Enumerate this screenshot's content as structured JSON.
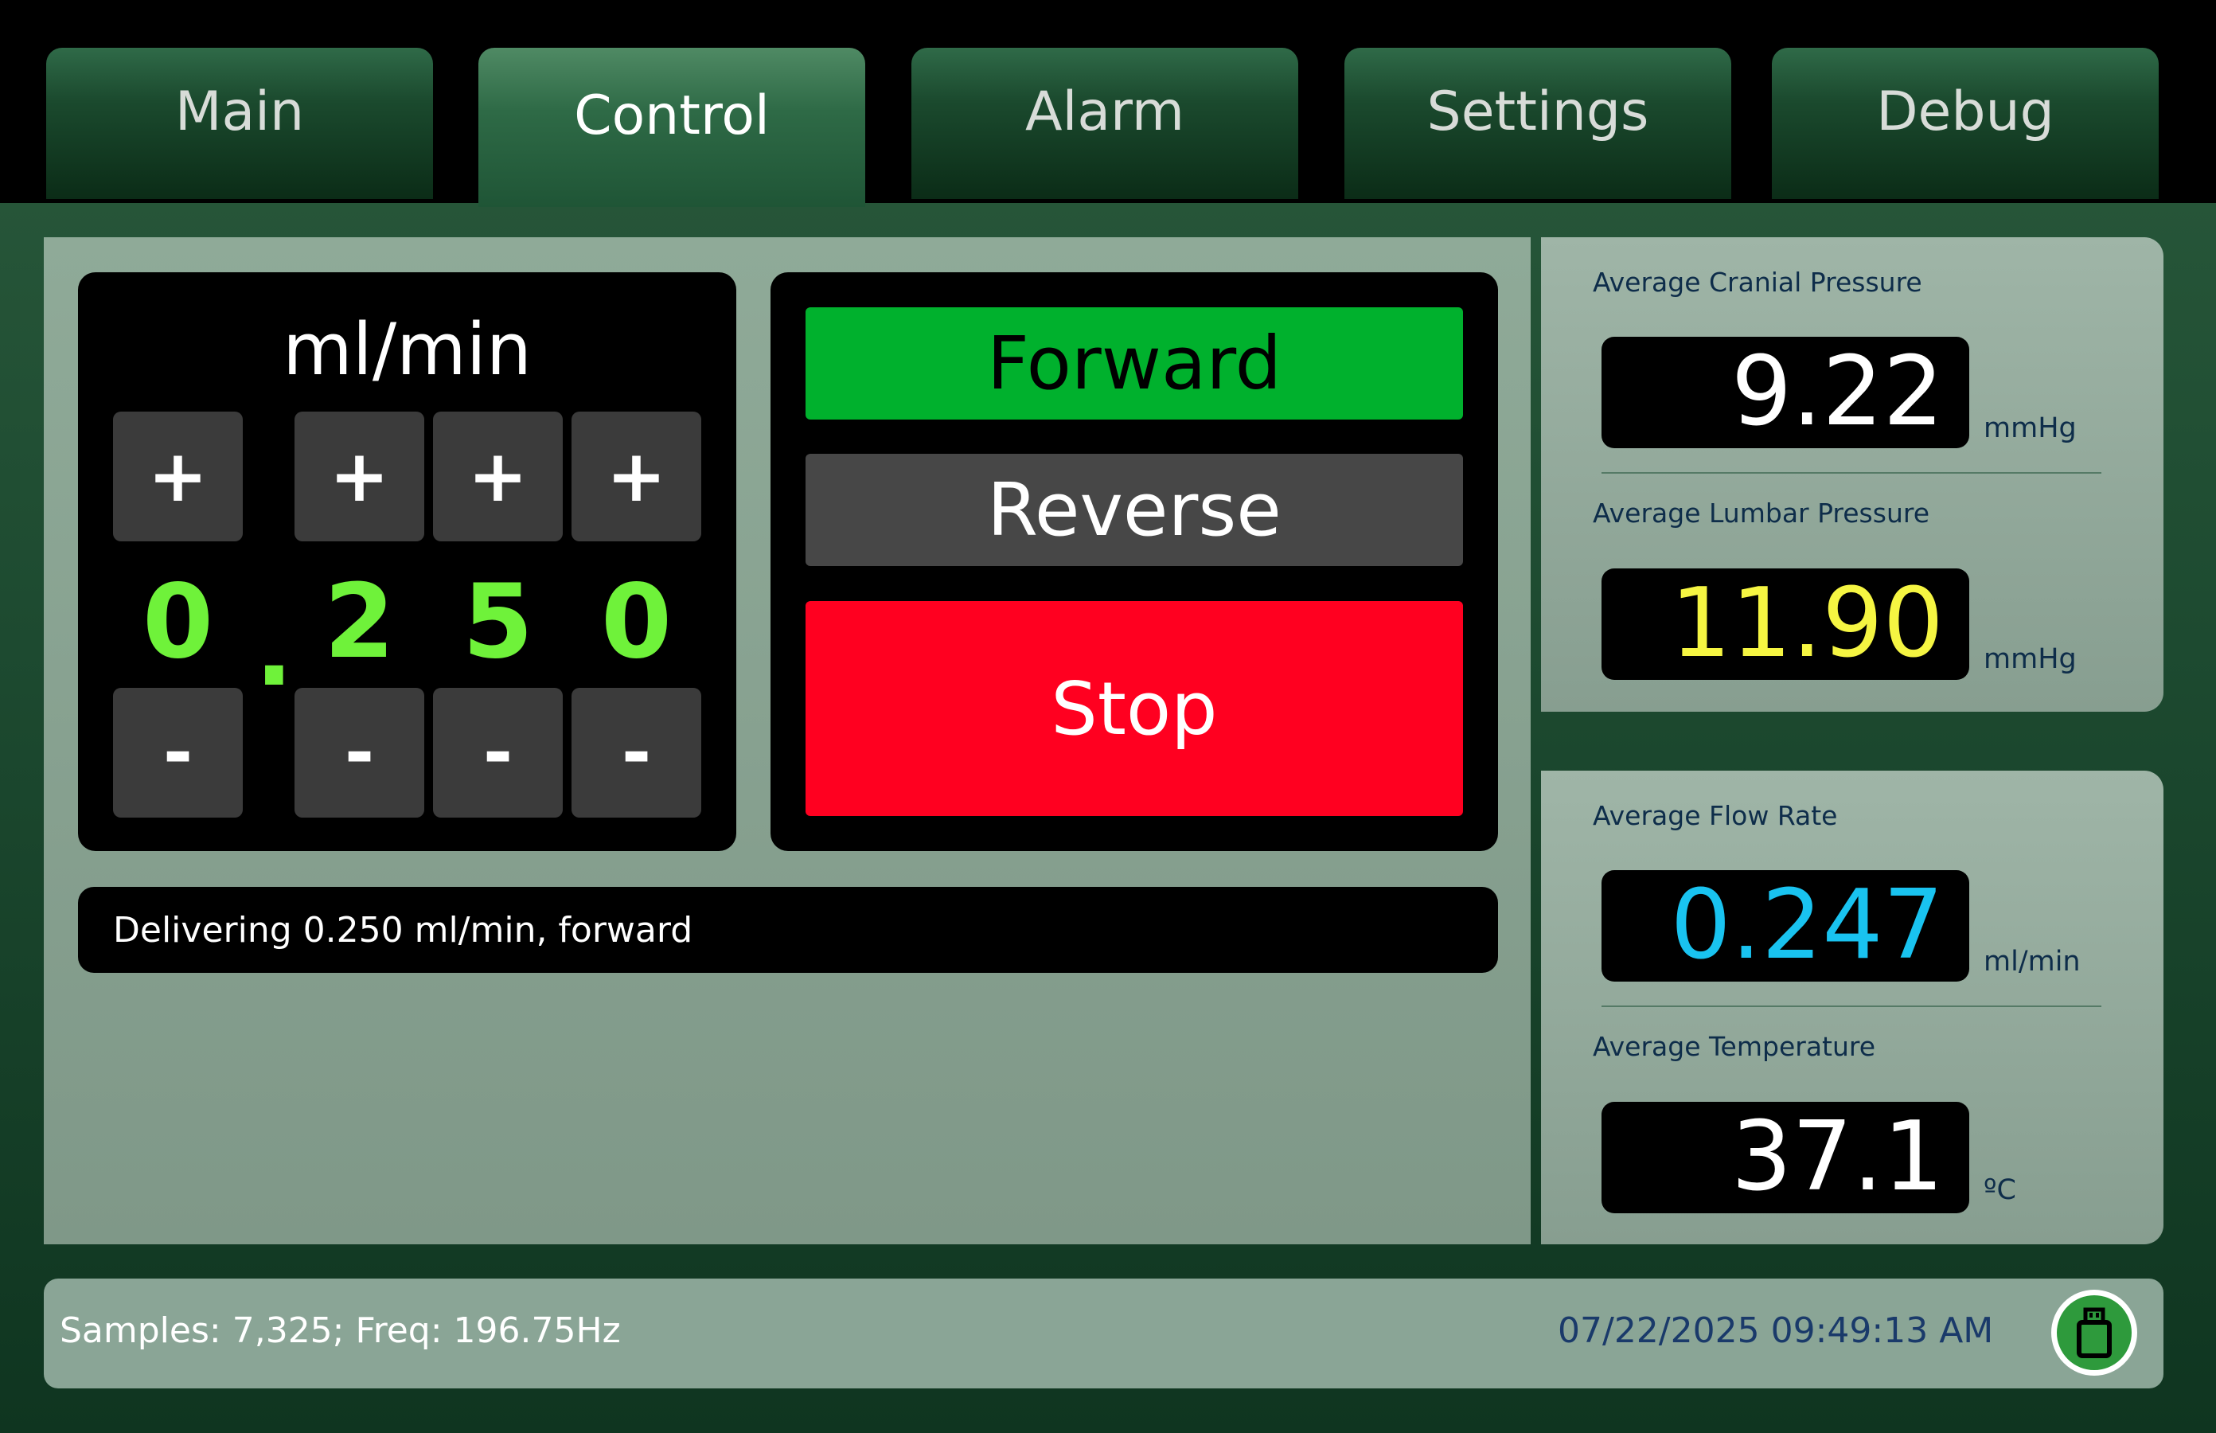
{
  "tabs": [
    "Main",
    "Control",
    "Alarm",
    "Settings",
    "Debug"
  ],
  "active_tab": "Control",
  "flow_control": {
    "units": "ml/min",
    "plus": "+",
    "minus": "-",
    "digits": [
      "0",
      "2",
      "5",
      "0"
    ],
    "decimal_point": "."
  },
  "direction": {
    "forward_label": "Forward",
    "reverse_label": "Reverse",
    "stop_label": "Stop",
    "selected": "Forward"
  },
  "status_message": "Delivering 0.250 ml/min, forward",
  "measurements": [
    {
      "label": "Average Cranial Pressure",
      "value": "9.22",
      "unit": "mmHg",
      "color": "#ffffff"
    },
    {
      "label": "Average Lumbar Pressure",
      "value": "11.90",
      "unit": "mmHg",
      "color": "#f5f542"
    },
    {
      "label": "Average Flow Rate",
      "value": "0.247",
      "unit": "ml/min",
      "color": "#19c3f0"
    },
    {
      "label": "Average Temperature",
      "value": "37.1",
      "unit": "ºC",
      "color": "#ffffff"
    }
  ],
  "footer": {
    "samples_text": "Samples: 7,325;  Freq: 196.75Hz",
    "datetime": "07/22/2025 09:49:13 AM",
    "icon": "usb-drive-icon"
  },
  "colors": {
    "forward": "#00b12d",
    "reverse": "#474747",
    "stop": "#ff0020",
    "digit": "#6ff23a"
  }
}
